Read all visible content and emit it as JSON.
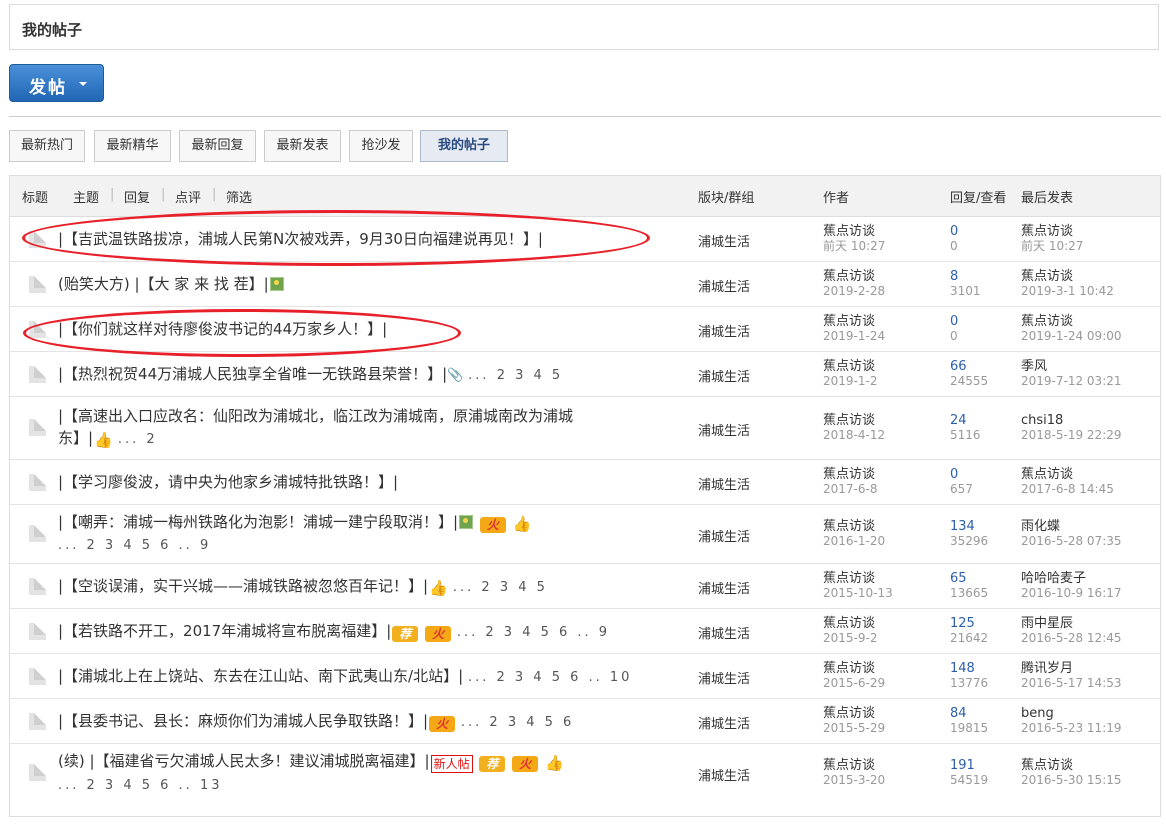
{
  "header": {
    "title": "我的帖子"
  },
  "post_button": {
    "label": "发帖"
  },
  "tabs": [
    "最新热门",
    "最新精华",
    "最新回复",
    "最新发表",
    "抢沙发",
    "我的帖子"
  ],
  "table_header": {
    "title": "标题",
    "topic": "主题",
    "reply": "回复",
    "comment": "点评",
    "filter": "筛选",
    "forum": "版块/群组",
    "author": "作者",
    "counts": "回复/查看",
    "last": "最后发表",
    "sep": "|"
  },
  "rows": [
    {
      "title": "|【吉武温铁路拔凉，浦城人民第N次被戏弄，9月30日向福建说再见！】|",
      "forum": "浦城生活",
      "author": "蕉点访谈",
      "date": "前天 10:27",
      "replies": "0",
      "views": "0",
      "last_user": "蕉点访谈",
      "last_date": "前天 10:27"
    },
    {
      "title": "(贻笑大方) |【大 家 来 找 茬】|",
      "forum": "浦城生活",
      "author": "蕉点访谈",
      "date": "2019-2-28",
      "replies": "8",
      "views": "3101",
      "last_user": "蕉点访谈",
      "last_date": "2019-3-1 10:42"
    },
    {
      "title": "|【你们就这样对待廖俊波书记的44万家乡人！】|",
      "forum": "浦城生活",
      "author": "蕉点访谈",
      "date": "2019-1-24",
      "replies": "0",
      "views": "0",
      "last_user": "蕉点访谈",
      "last_date": "2019-1-24 09:00"
    },
    {
      "title": "|【热烈祝贺44万浦城人民独享全省唯一无铁路县荣誉！】|",
      "pages": "... 2 3 4 5",
      "forum": "浦城生活",
      "author": "蕉点访谈",
      "date": "2019-1-2",
      "replies": "66",
      "views": "24555",
      "last_user": "季风",
      "last_date": "2019-7-12 03:21"
    },
    {
      "title": "|【高速出入口应改名：仙阳改为浦城北，临江改为浦城南，原浦城南改为浦城",
      "title2": "东】|",
      "pages": "... 2",
      "forum": "浦城生活",
      "author": "蕉点访谈",
      "date": "2018-4-12",
      "replies": "24",
      "views": "5116",
      "last_user": "chsi18",
      "last_date": "2018-5-19 22:29"
    },
    {
      "title": "|【学习廖俊波，请中央为他家乡浦城特批铁路！】|",
      "forum": "浦城生活",
      "author": "蕉点访谈",
      "date": "2017-6-8",
      "replies": "0",
      "views": "657",
      "last_user": "蕉点访谈",
      "last_date": "2017-6-8 14:45"
    },
    {
      "title": "|【嘲弄：浦城一梅州铁路化为泡影！浦城一建宁段取消！】|",
      "pages": "... 2 3 4 5 6 .. 9",
      "forum": "浦城生活",
      "author": "蕉点访谈",
      "date": "2016-1-20",
      "replies": "134",
      "views": "35296",
      "last_user": "雨化蝶",
      "last_date": "2016-5-28 07:35"
    },
    {
      "title": "|【空谈误浦，实干兴城——浦城铁路被忽悠百年记！】|",
      "pages": "... 2 3 4 5",
      "forum": "浦城生活",
      "author": "蕉点访谈",
      "date": "2015-10-13",
      "replies": "65",
      "views": "13665",
      "last_user": "哈哈哈麦子",
      "last_date": "2016-10-9 16:17"
    },
    {
      "title": "|【若铁路不开工，2017年浦城将宣布脱离福建】|",
      "pages": "... 2 3 4 5 6 .. 9",
      "forum": "浦城生活",
      "author": "蕉点访谈",
      "date": "2015-9-2",
      "replies": "125",
      "views": "21642",
      "last_user": "雨中星辰",
      "last_date": "2016-5-28 12:45"
    },
    {
      "title": "|【浦城北上在上饶站、东去在江山站、南下武夷山东/北站】|",
      "pages": "... 2 3 4 5 6 .. 10",
      "forum": "浦城生活",
      "author": "蕉点访谈",
      "date": "2015-6-29",
      "replies": "148",
      "views": "13776",
      "last_user": "腾讯岁月",
      "last_date": "2016-5-17 14:53"
    },
    {
      "title": "|【县委书记、县长：麻烦你们为浦城人民争取铁路！】|",
      "pages": "... 2 3 4 5 6",
      "forum": "浦城生活",
      "author": "蕉点访谈",
      "date": "2015-5-29",
      "replies": "84",
      "views": "19815",
      "last_user": "beng",
      "last_date": "2016-5-23 11:19"
    },
    {
      "title": "(续) |【福建省亏欠浦城人民太多！建议浦城脱离福建】|",
      "pages": "... 2 3 4 5 6 .. 13",
      "forum": "浦城生活",
      "author": "蕉点访谈",
      "date": "2015-3-20",
      "replies": "191",
      "views": "54519",
      "last_user": "蕉点访谈",
      "last_date": "2016-5-30 15:15"
    }
  ],
  "badges": {
    "fire": "火",
    "recommend": "荐",
    "new_post": "新人帖"
  },
  "icons": [
    "folder-icon",
    "image-icon",
    "attachment-icon",
    "thumbs-up-icon",
    "fire-icon",
    "recommend-icon"
  ],
  "colors": {
    "accent": "#2166b4",
    "link": "#2b5fad",
    "annotation": "#e8202a"
  }
}
